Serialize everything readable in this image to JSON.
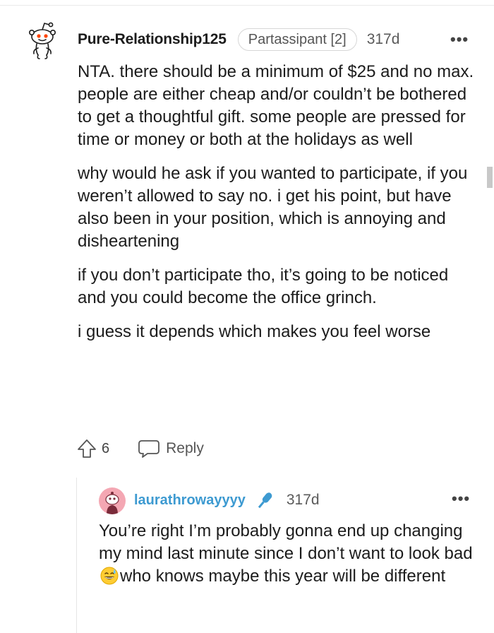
{
  "comment": {
    "username": "Pure-Relationship125",
    "flair": "Partassipant [2]",
    "age": "317d",
    "more": "•••",
    "paragraphs": [
      "NTA. there should be a minimum of $25 and no max. people are either cheap and/or couldn’t be bothered to get a thoughtful gift. some people are pressed for time or money or both at the holidays as well",
      "why would he ask if you wanted to participate, if you weren’t allowed to say no. i get his point, but have also been in your position, which is annoying and disheartening",
      "if you don’t participate tho, it’s going to be noticed and you could become the office grinch.",
      "i guess it depends which makes you feel worse"
    ],
    "votes": "6",
    "reply_label": "Reply"
  },
  "reply": {
    "username": "laurathrowayyyy",
    "age": "317d",
    "more": "•••",
    "text_before_emoji": "You’re right I’m probably gonna end up changing my mind last minute since I don’t want to look bad ",
    "text_after_emoji": "who knows maybe this year will be different",
    "emoji": "sweat-smile-emoji"
  },
  "icons": {
    "upvote": "upvote-icon",
    "reply": "reply-bubble-icon",
    "mic": "microphone-icon",
    "avatar": "snoo-avatar-icon"
  },
  "colors": {
    "reply_username": "#3d9ad1",
    "avatar_pink": "#f4a7b3",
    "snoo_eye": "#ff4500"
  }
}
